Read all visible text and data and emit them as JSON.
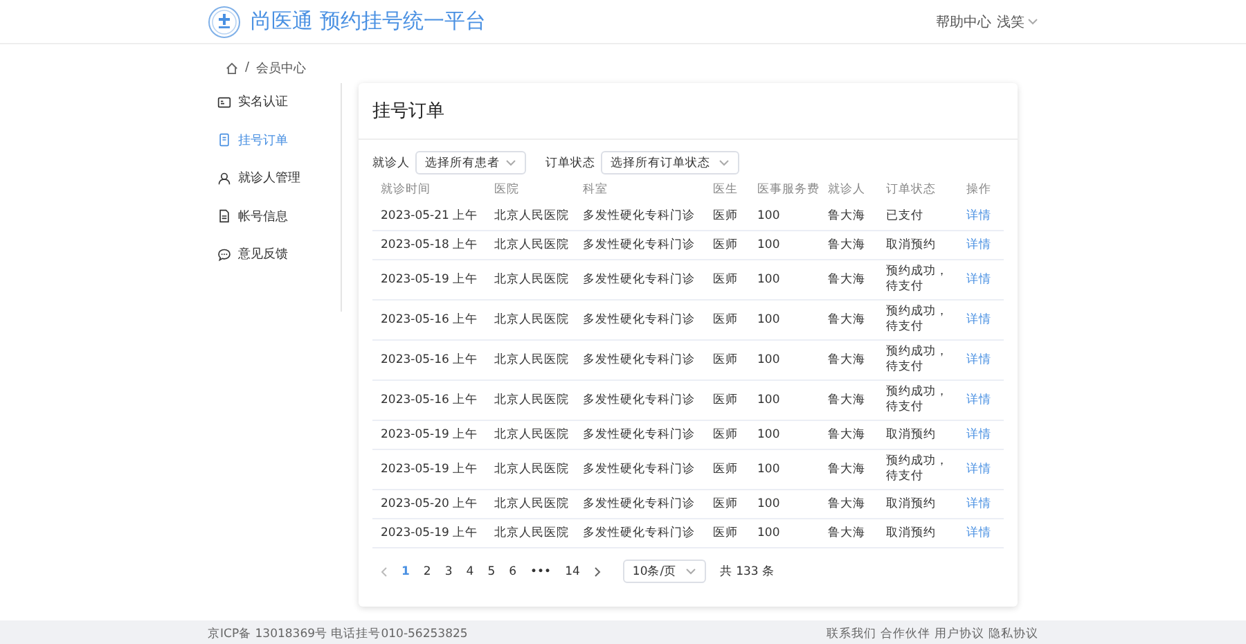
{
  "header": {
    "title": "尚医通 预约挂号统一平台",
    "help": "帮助中心",
    "user": "浅笑"
  },
  "breadcrumb": {
    "separator": "/",
    "current": "会员中心"
  },
  "sidebar": {
    "items": [
      {
        "label": "实名认证",
        "kind": "id-card",
        "selected": false
      },
      {
        "label": "挂号订单",
        "kind": "order",
        "selected": true
      },
      {
        "label": "就诊人管理",
        "kind": "person",
        "selected": false
      },
      {
        "label": "帐号信息",
        "kind": "document",
        "selected": false
      },
      {
        "label": "意见反馈",
        "kind": "chat",
        "selected": false
      }
    ]
  },
  "card": {
    "title": "挂号订单",
    "filters": [
      {
        "label": "就诊人",
        "placeholder": "选择所有患者"
      },
      {
        "label": "订单状态",
        "placeholder": "选择所有订单状态"
      }
    ],
    "table": {
      "columns": [
        {
          "label": "就诊时间",
          "kind": "text"
        },
        {
          "label": "医院",
          "kind": "text"
        },
        {
          "label": "科室",
          "kind": "text"
        },
        {
          "label": "医生",
          "kind": "text"
        },
        {
          "label": "医事服务费",
          "kind": "text"
        },
        {
          "label": "就诊人",
          "kind": "text"
        },
        {
          "label": "订单状态",
          "kind": "text"
        },
        {
          "label": "操作",
          "kind": "link"
        }
      ],
      "rows": [
        [
          "2023-05-21 上午",
          "北京人民医院",
          "多发性硬化专科门诊",
          "医师",
          "100",
          "鲁大海",
          "已支付",
          "详情"
        ],
        [
          "2023-05-18 上午",
          "北京人民医院",
          "多发性硬化专科门诊",
          "医师",
          "100",
          "鲁大海",
          "取消预约",
          "详情"
        ],
        [
          "2023-05-19 上午",
          "北京人民医院",
          "多发性硬化专科门诊",
          "医师",
          "100",
          "鲁大海",
          "预约成功，待支付",
          "详情"
        ],
        [
          "2023-05-16 上午",
          "北京人民医院",
          "多发性硬化专科门诊",
          "医师",
          "100",
          "鲁大海",
          "预约成功，待支付",
          "详情"
        ],
        [
          "2023-05-16 上午",
          "北京人民医院",
          "多发性硬化专科门诊",
          "医师",
          "100",
          "鲁大海",
          "预约成功，待支付",
          "详情"
        ],
        [
          "2023-05-16 上午",
          "北京人民医院",
          "多发性硬化专科门诊",
          "医师",
          "100",
          "鲁大海",
          "预约成功，待支付",
          "详情"
        ],
        [
          "2023-05-19 上午",
          "北京人民医院",
          "多发性硬化专科门诊",
          "医师",
          "100",
          "鲁大海",
          "取消预约",
          "详情"
        ],
        [
          "2023-05-19 上午",
          "北京人民医院",
          "多发性硬化专科门诊",
          "医师",
          "100",
          "鲁大海",
          "预约成功，待支付",
          "详情"
        ],
        [
          "2023-05-20 上午",
          "北京人民医院",
          "多发性硬化专科门诊",
          "医师",
          "100",
          "鲁大海",
          "取消预约",
          "详情"
        ],
        [
          "2023-05-19 上午",
          "北京人民医院",
          "多发性硬化专科门诊",
          "医师",
          "100",
          "鲁大海",
          "取消预约",
          "详情"
        ]
      ]
    },
    "pagination": {
      "pages": [
        {
          "label": "1",
          "selected": true
        },
        {
          "label": "2",
          "selected": false
        },
        {
          "label": "3",
          "selected": false
        },
        {
          "label": "4",
          "selected": false
        },
        {
          "label": "5",
          "selected": false
        },
        {
          "label": "6",
          "selected": false
        },
        {
          "label": "•••",
          "selected": false
        },
        {
          "label": "14",
          "selected": false
        }
      ],
      "page_size": "10条/页",
      "total": "共 133 条"
    }
  },
  "footer": {
    "text": "京ICP备 13018369号 电话挂号010-56253825",
    "links": [
      "联系我们",
      "合作伙伴",
      "用户协议",
      "隐私协议"
    ]
  }
}
